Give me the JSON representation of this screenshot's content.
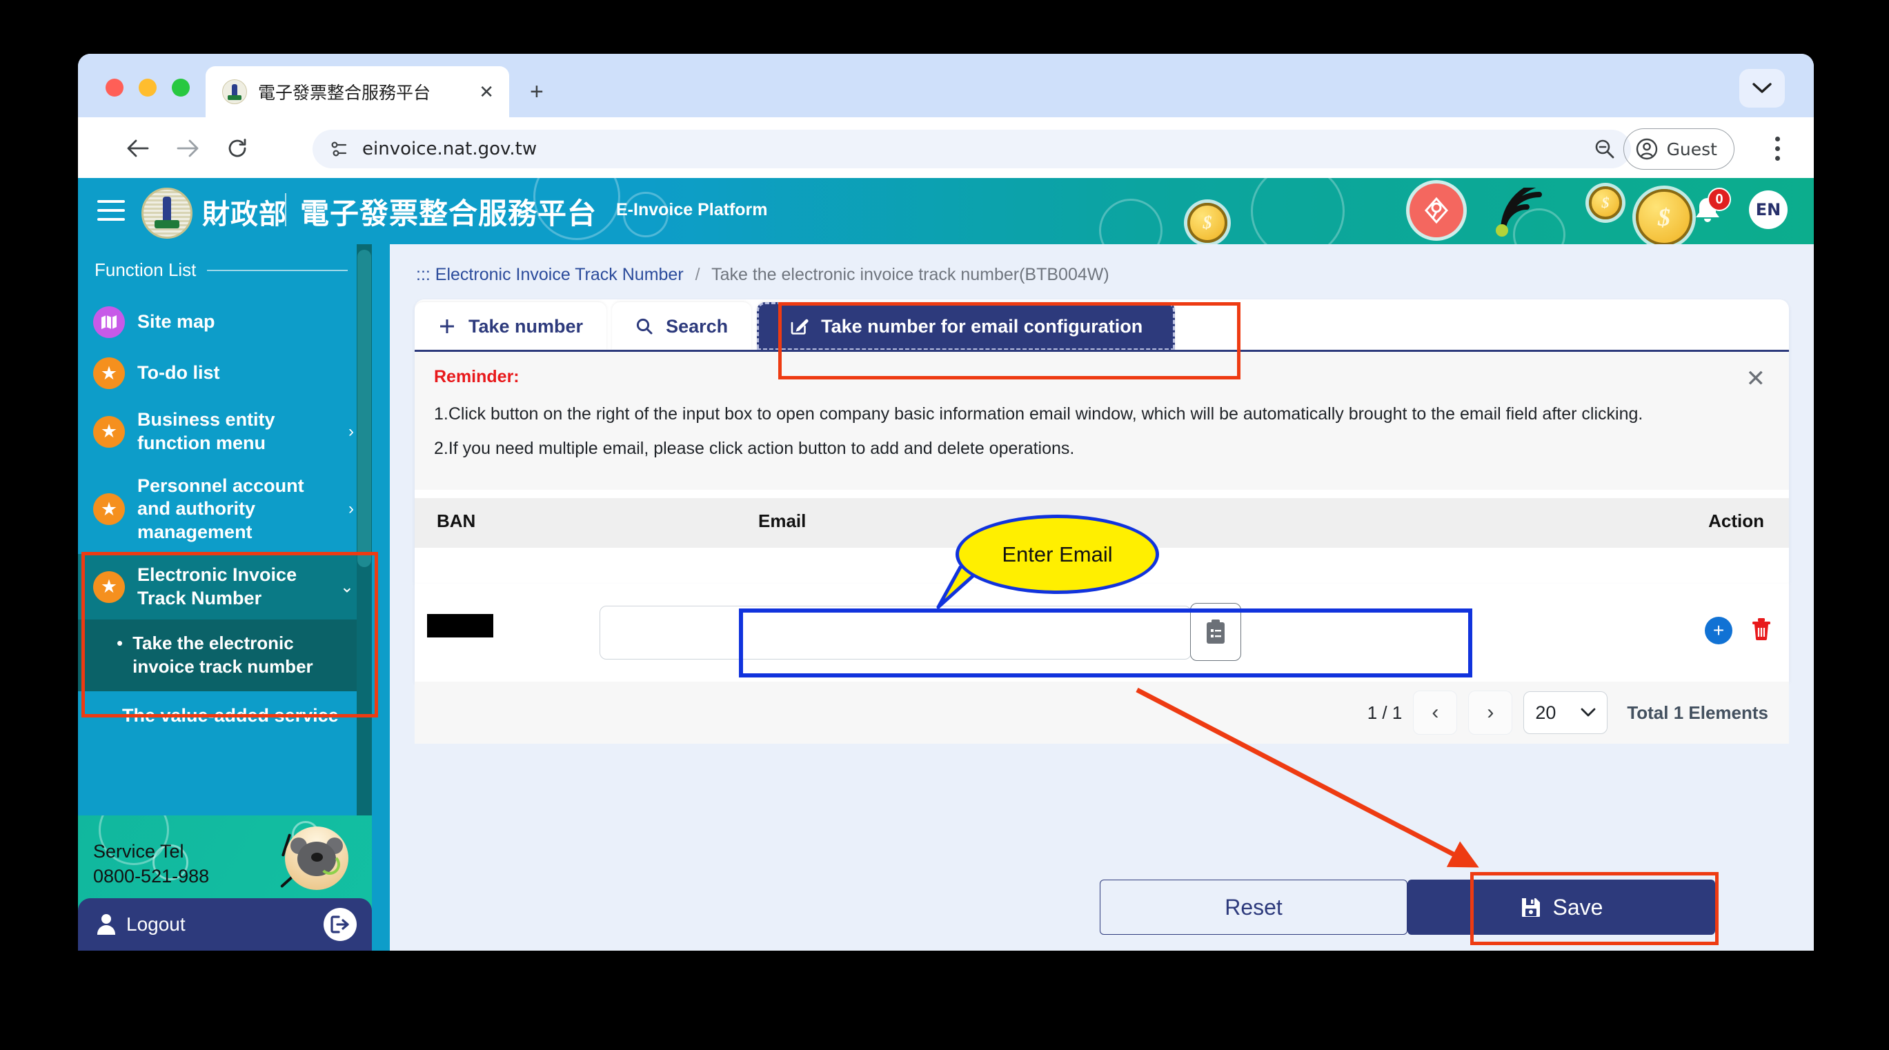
{
  "browser": {
    "tab_title": "電子發票整合服務平台",
    "favicon": "mof-seal-icon",
    "new_tab_label": "+",
    "close_tab_label": "✕",
    "back_icon": "back-arrow-icon",
    "forward_icon": "forward-arrow-icon",
    "reload_icon": "reload-icon",
    "site_info_icon": "site-settings-icon",
    "url": "einvoice.nat.gov.tw",
    "zoom_icon": "zoom-out-icon",
    "profile_label": "Guest",
    "menu_icon": "kebab-menu-icon",
    "tabstrip_chevron": "chevron-down-icon"
  },
  "appheader": {
    "menu_icon": "hamburger-icon",
    "logo": "mof-seal-icon",
    "ministry": "財政部",
    "platform_cn": "電子發票整合服務平台",
    "platform_en": "E-Invoice Platform",
    "bell_icon": "bell-icon",
    "bell_badge": "0",
    "language": "EN"
  },
  "sidebar": {
    "heading": "Function List",
    "collapse_glyph": "–",
    "items": [
      {
        "label": "Site map",
        "icon": "map-icon",
        "icon_color": "#c75ae8",
        "chevron": ""
      },
      {
        "label": "To-do list",
        "icon": "star-icon",
        "icon_color": "#f5901e",
        "chevron": ""
      },
      {
        "label": "Business entity function menu",
        "icon": "star-icon",
        "icon_color": "#f5901e",
        "chevron": "›"
      },
      {
        "label": "Personnel account and authority management",
        "icon": "star-icon",
        "icon_color": "#f5901e",
        "chevron": "›"
      },
      {
        "label": "Electronic Invoice Track Number",
        "icon": "star-icon",
        "icon_color": "#f5901e",
        "chevron": "⌄"
      }
    ],
    "sub_item": {
      "bullet": "•",
      "label": "Take the electronic invoice track number"
    },
    "next_item": "The value-added service",
    "service_tel_label": "Service Tel",
    "service_tel_number": "0800-521-988",
    "mascot": "koala-support-avatar",
    "logout_label": "Logout",
    "logout_icon": "logout-icon"
  },
  "breadcrumb": {
    "anchor": ":::",
    "parent": "Electronic Invoice Track Number",
    "separator": "/",
    "current": "Take the electronic invoice track number(BTB004W)"
  },
  "tabs": [
    {
      "label": "Take number",
      "icon": "plus-icon",
      "selected": false
    },
    {
      "label": "Search",
      "icon": "search-icon",
      "selected": false
    },
    {
      "label": "Take number for email configuration",
      "icon": "edit-square-icon",
      "selected": true
    }
  ],
  "reminder": {
    "title": "Reminder:",
    "line1": "1.Click button on the right of the input box to open company basic information email window, which will be automatically brought to the email field after clicking.",
    "line2": "2.If you need multiple email, please click action button to add and delete operations.",
    "close_icon": "close-icon"
  },
  "table": {
    "columns": [
      "BAN",
      "Email",
      "Action"
    ],
    "rows": [
      {
        "ban": "",
        "ban_redacted": true,
        "email": "",
        "email_placeholder": "",
        "clipboard_icon": "clipboard-list-icon",
        "add_icon": "plus-circle-icon",
        "delete_icon": "trash-icon"
      }
    ]
  },
  "pagination": {
    "page_indicator": "1 / 1",
    "prev_icon": "chevron-left-icon",
    "next_icon": "chevron-right-icon",
    "page_size": "20",
    "page_size_chevron": "chevron-down-icon",
    "total_label": "Total 1 Elements"
  },
  "footer": {
    "reset_label": "Reset",
    "save_label": "Save",
    "save_icon": "floppy-save-icon"
  },
  "annotations": {
    "callout_text": "Enter Email",
    "callout_fill": "#ffef00",
    "callout_stroke": "#1133dd",
    "highlight_color": "#ee3b12",
    "focus_color": "#1133dd"
  }
}
